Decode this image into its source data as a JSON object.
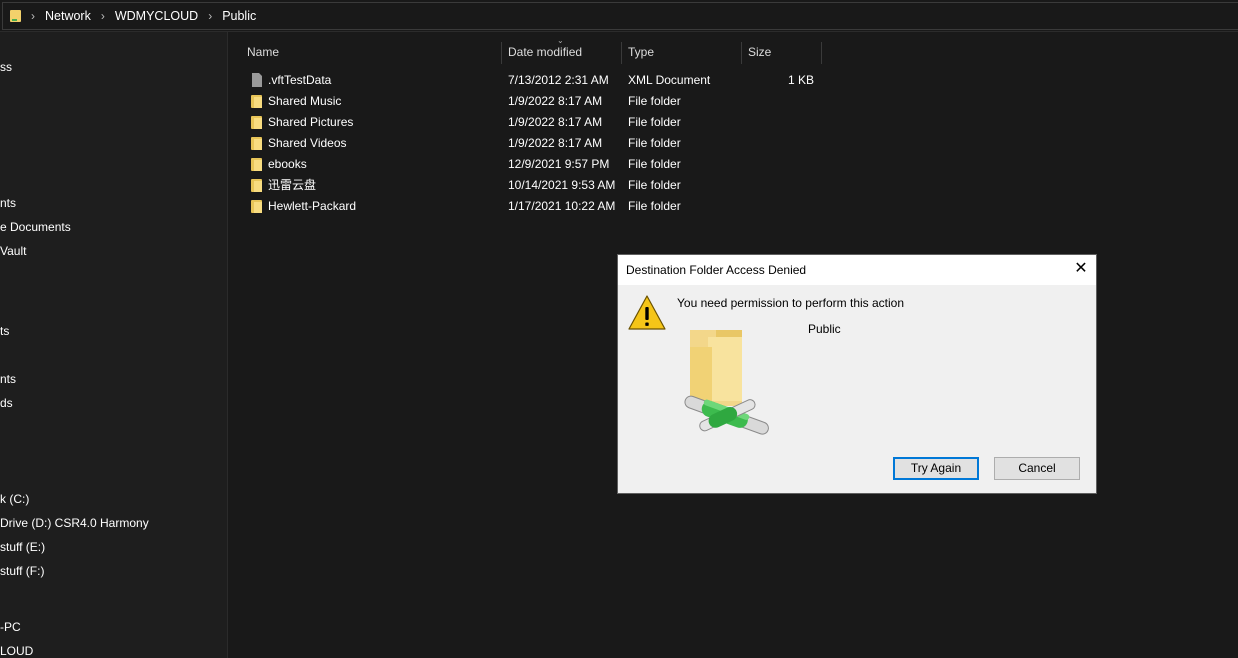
{
  "address_bar": {
    "crumbs": [
      "Network",
      "WDMYCLOUD",
      "Public"
    ]
  },
  "nav": {
    "items": [
      {
        "label": "ss"
      },
      {
        "label": "nts"
      },
      {
        "label": "e Documents"
      },
      {
        "label": "Vault"
      },
      {
        "label": "ts"
      },
      {
        "label": "nts"
      },
      {
        "label": "ds"
      },
      {
        "label": "k (C:)"
      },
      {
        "label": "Drive (D:) CSR4.0 Harmony"
      },
      {
        "label": "stuff (E:)"
      },
      {
        "label": "stuff (F:)"
      },
      {
        "label": "-PC"
      },
      {
        "label": "LOUD"
      }
    ]
  },
  "columns": {
    "name": "Name",
    "date": "Date modified",
    "type": "Type",
    "size": "Size"
  },
  "files": [
    {
      "name": ".vftTestData",
      "date": "7/13/2012 2:31 AM",
      "type": "XML Document",
      "size": "1 KB",
      "icon": "file-icon"
    },
    {
      "name": "Shared Music",
      "date": "1/9/2022 8:17 AM",
      "type": "File folder",
      "size": "",
      "icon": "folder-icon"
    },
    {
      "name": "Shared Pictures",
      "date": "1/9/2022 8:17 AM",
      "type": "File folder",
      "size": "",
      "icon": "folder-icon"
    },
    {
      "name": "Shared Videos",
      "date": "1/9/2022 8:17 AM",
      "type": "File folder",
      "size": "",
      "icon": "folder-icon"
    },
    {
      "name": "ebooks",
      "date": "12/9/2021 9:57 PM",
      "type": "File folder",
      "size": "",
      "icon": "folder-icon"
    },
    {
      "name": "迅雷云盘",
      "date": "10/14/2021 9:53 AM",
      "type": "File folder",
      "size": "",
      "icon": "folder-icon"
    },
    {
      "name": "Hewlett-Packard",
      "date": "1/17/2021 10:22 AM",
      "type": "File folder",
      "size": "",
      "icon": "folder-icon"
    }
  ],
  "dialog": {
    "title": "Destination Folder Access Denied",
    "message": "You need permission to perform this action",
    "folder_name": "Public",
    "try_again_label": "Try Again",
    "cancel_label": "Cancel",
    "close_glyph": "✕"
  }
}
